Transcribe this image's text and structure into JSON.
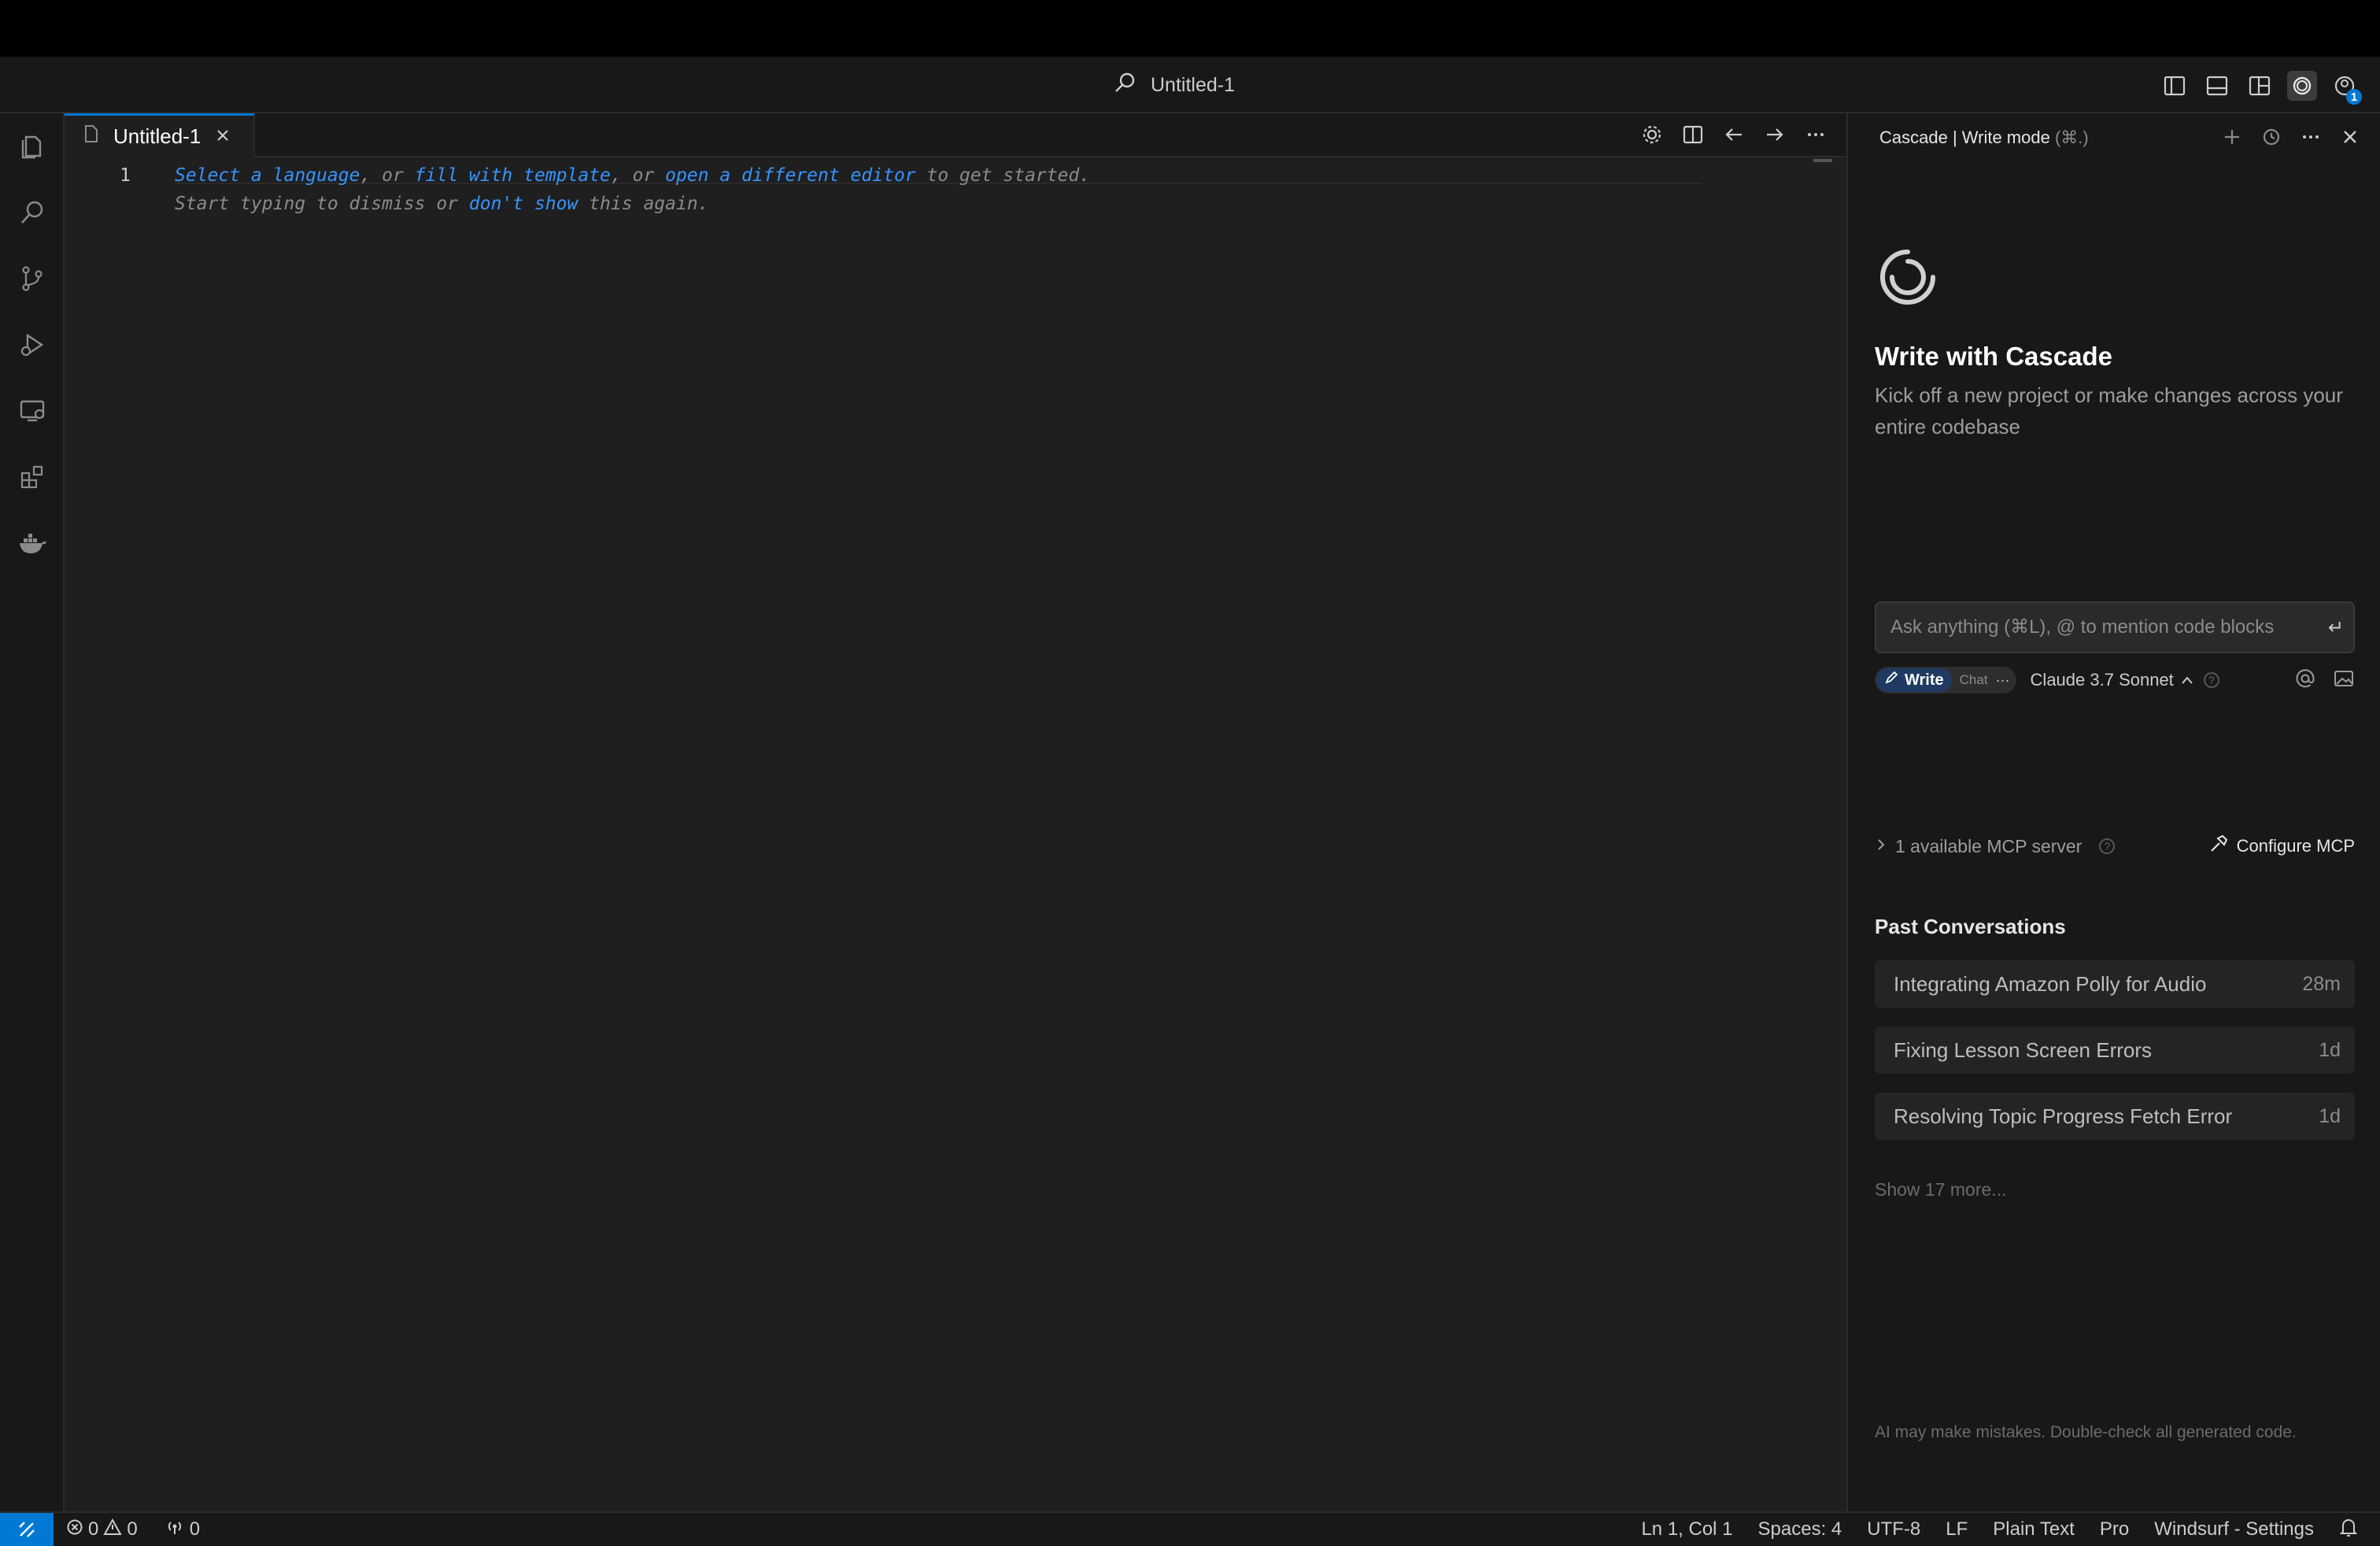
{
  "titlebar": {
    "search_text": "Untitled-1",
    "icons": [
      "toggle-primary-sidebar-icon",
      "toggle-panel-icon",
      "customize-layout-icon",
      "cascade-icon",
      "account-icon"
    ],
    "account_badge": "1"
  },
  "activity_bar": {
    "items": [
      "explorer-icon",
      "search-icon",
      "source-control-icon",
      "run-debug-icon",
      "remote-explorer-icon",
      "extensions-icon",
      "docker-icon"
    ]
  },
  "editor": {
    "tab_label": "Untitled-1",
    "line_number": "1",
    "hint": {
      "select_language": "Select a language",
      "sep1": ", or ",
      "fill_template": "fill with template",
      "sep2": ", or ",
      "open_editor": "open a different editor",
      "tail1": " to get started.",
      "start_typing": "Start typing to dismiss or ",
      "dont_show": "don't show",
      "tail2": " this again."
    }
  },
  "cascade": {
    "header_title": "Cascade | Write mode",
    "header_shortcut": "(⌘.)",
    "title": "Write with Cascade",
    "subtitle": "Kick off a new project or make changes across your entire codebase",
    "input_placeholder": "Ask anything (⌘L), @ to mention code blocks",
    "write_label": "Write",
    "chat_label": "Chat",
    "more_label": "···",
    "model": "Claude 3.7 Sonnet",
    "mcp_text": "1 available MCP server",
    "configure_label": "Configure MCP",
    "past_title": "Past Conversations",
    "conversations": [
      {
        "title": "Integrating Amazon Polly for Audio",
        "time": "28m"
      },
      {
        "title": "Fixing Lesson Screen Errors",
        "time": "1d"
      },
      {
        "title": "Resolving Topic Progress Fetch Error",
        "time": "1d"
      }
    ],
    "show_more": "Show 17 more...",
    "disclaimer": "AI may make mistakes. Double-check all generated code."
  },
  "statusbar": {
    "errors": "0",
    "warnings": "0",
    "ports": "0",
    "position": "Ln 1, Col 1",
    "spaces": "Spaces: 4",
    "encoding": "UTF-8",
    "eol": "LF",
    "language": "Plain Text",
    "plan": "Pro",
    "settings": "Windsurf - Settings"
  },
  "colors": {
    "accent": "#0078d4",
    "link": "#3794ff",
    "background": "#1f1f1f",
    "sidebar": "#181818"
  }
}
